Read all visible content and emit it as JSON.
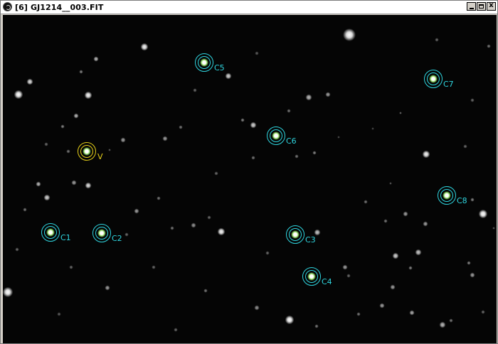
{
  "window": {
    "title": "[6] GJ1214__003.FIT",
    "buttons": {
      "minimize": "minimize",
      "maximize": "maximize",
      "close": "x"
    }
  },
  "colors": {
    "target_aperture": "#e8d21a",
    "comparison_aperture": "#2fd6e0",
    "star_core": "#ffffff",
    "sky_background": "#050505"
  },
  "apertures": [
    {
      "label": "V",
      "role": "target"
    },
    {
      "label": "C1",
      "role": "comparison"
    },
    {
      "label": "C2",
      "role": "comparison"
    },
    {
      "label": "C3",
      "role": "comparison"
    },
    {
      "label": "C4",
      "role": "comparison"
    },
    {
      "label": "C5",
      "role": "comparison"
    },
    {
      "label": "C6",
      "role": "comparison"
    },
    {
      "label": "C7",
      "role": "comparison"
    },
    {
      "label": "C8",
      "role": "comparison"
    }
  ]
}
